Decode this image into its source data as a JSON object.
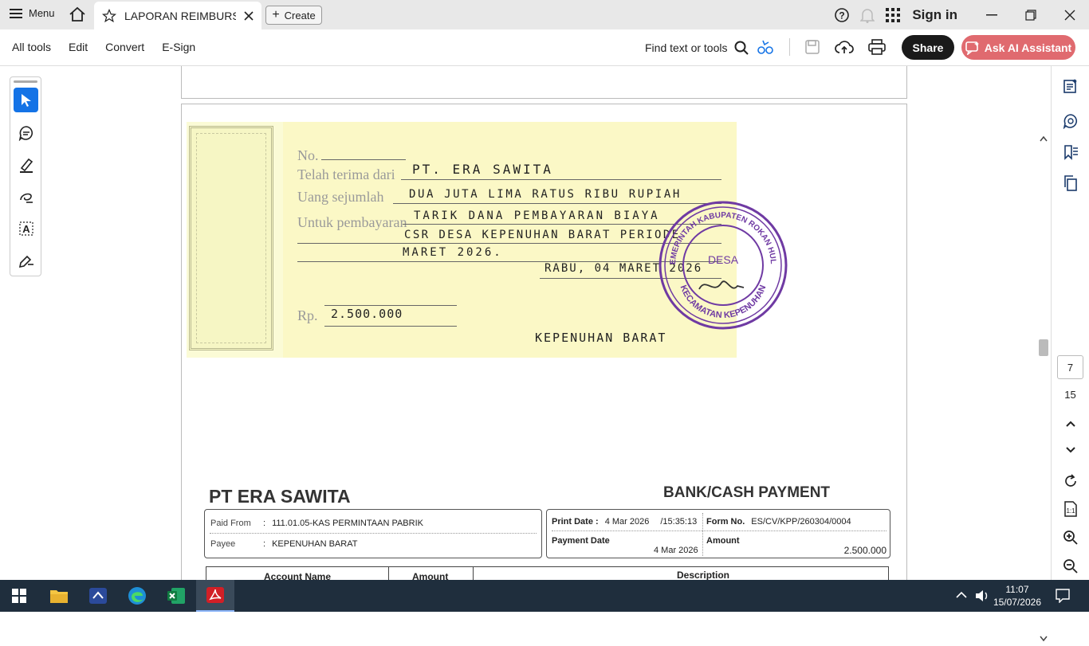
{
  "titlebar": {
    "menu_label": "Menu",
    "tab_title": "LAPORAN REIMBURSE ...",
    "create_label": "Create",
    "signin_label": "Sign in"
  },
  "toolbar": {
    "menus": [
      "All tools",
      "Edit",
      "Convert",
      "E-Sign"
    ],
    "find_label": "Find text or tools",
    "share_label": "Share",
    "ai_label": "Ask AI Assistant"
  },
  "receipt": {
    "no_label": "No.",
    "received_from_label": "Telah terima dari",
    "received_from_value": "PT. ERA SAWITA",
    "amount_words_label": "Uang sejumlah",
    "amount_words_value": "DUA JUTA LIMA RATUS RIBU RUPIAH",
    "purpose_label": "Untuk pembayaran",
    "purpose_line1": "TARIK DANA PEMBAYARAN BIAYA",
    "purpose_line2": "CSR DESA KEPENUHAN BARAT PERIODE",
    "purpose_line3": "MARET 2026.",
    "date_value": "RABU, 04 MARET 2026",
    "rp_label": "Rp.",
    "rp_value": "2.500.000",
    "signer": "KEPENUHAN BARAT",
    "stamp_top": "PEMERINTAH KABUPATEN ROKAN HULU",
    "stamp_bottom": "KECAMATAN KEPENUHAN",
    "stamp_center": "DESA"
  },
  "voucher": {
    "company": "PT ERA SAWITA",
    "title": "BANK/CASH PAYMENT",
    "paid_from_label": "Paid From",
    "paid_from_value": "111.01.05-KAS PERMINTAAN PABRIK",
    "payee_label": "Payee",
    "payee_value": "KEPENUHAN BARAT",
    "print_date_label": "Print Date :",
    "print_date_value": "4 Mar 2026",
    "print_time_value": "/15:35:13",
    "form_no_label": "Form No.",
    "form_no_value": "ES/CV/KPP/260304/0004",
    "payment_date_label": "Payment Date",
    "payment_date_value": "4 Mar 2026",
    "amount_label": "Amount",
    "amount_value": "2.500.000",
    "col_account": "Account Name",
    "col_amount": "Amount",
    "col_description": "Description"
  },
  "rightrail": {
    "page_current": "7",
    "page_total": "15"
  },
  "taskbar": {
    "time": "11:07",
    "date": "15/07/2026"
  }
}
